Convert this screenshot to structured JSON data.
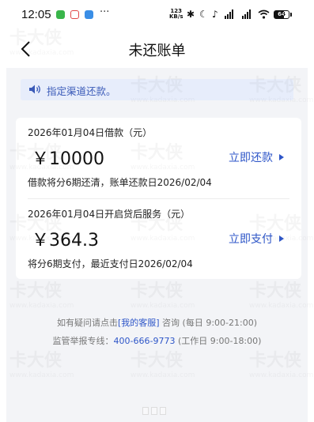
{
  "status_bar": {
    "time": "12:05",
    "overflow": "···",
    "speed_value": "123",
    "speed_unit": "KB/s",
    "battery_level": "64",
    "battery_fraction": 0.64,
    "icons": [
      "bluetooth-icon",
      "moon-icon",
      "bell-icon",
      "signal-icon",
      "signal-icon",
      "wifi-icon",
      "battery-icon"
    ]
  },
  "nav": {
    "title": "未还账单",
    "back_icon": "chevron-left-icon"
  },
  "notice": {
    "icon": "speaker-icon",
    "text": "指定渠道还款。"
  },
  "bills": [
    {
      "date_title": "2026年01月04日借款（元）",
      "amount": "￥10000",
      "note": "借款将分6期还清，账单还款日2026/02/04",
      "action": "立即还款"
    },
    {
      "date_title": "2026年01月04日开启贷后服务（元）",
      "amount": "￥364.3",
      "note": "将分6期支付，最近支付日2026/02/04",
      "action": "立即支付"
    }
  ],
  "help": {
    "line1_prefix": "如有疑问请点击",
    "line1_link": "[我的客服]",
    "line1_suffix": " 咨询 (每日 9:00-21:00)",
    "line2_prefix": "监管举报专线：",
    "line2_link": "400-666-9773",
    "line2_suffix": " (工作日 9:00-18:00)"
  },
  "watermark": {
    "text": "卡大侠",
    "url": "www.kadaxia.com"
  },
  "colors": {
    "accent": "#2e56c8",
    "notice_bg": "#e7edfb",
    "page_bg": "#f3f4f7"
  }
}
